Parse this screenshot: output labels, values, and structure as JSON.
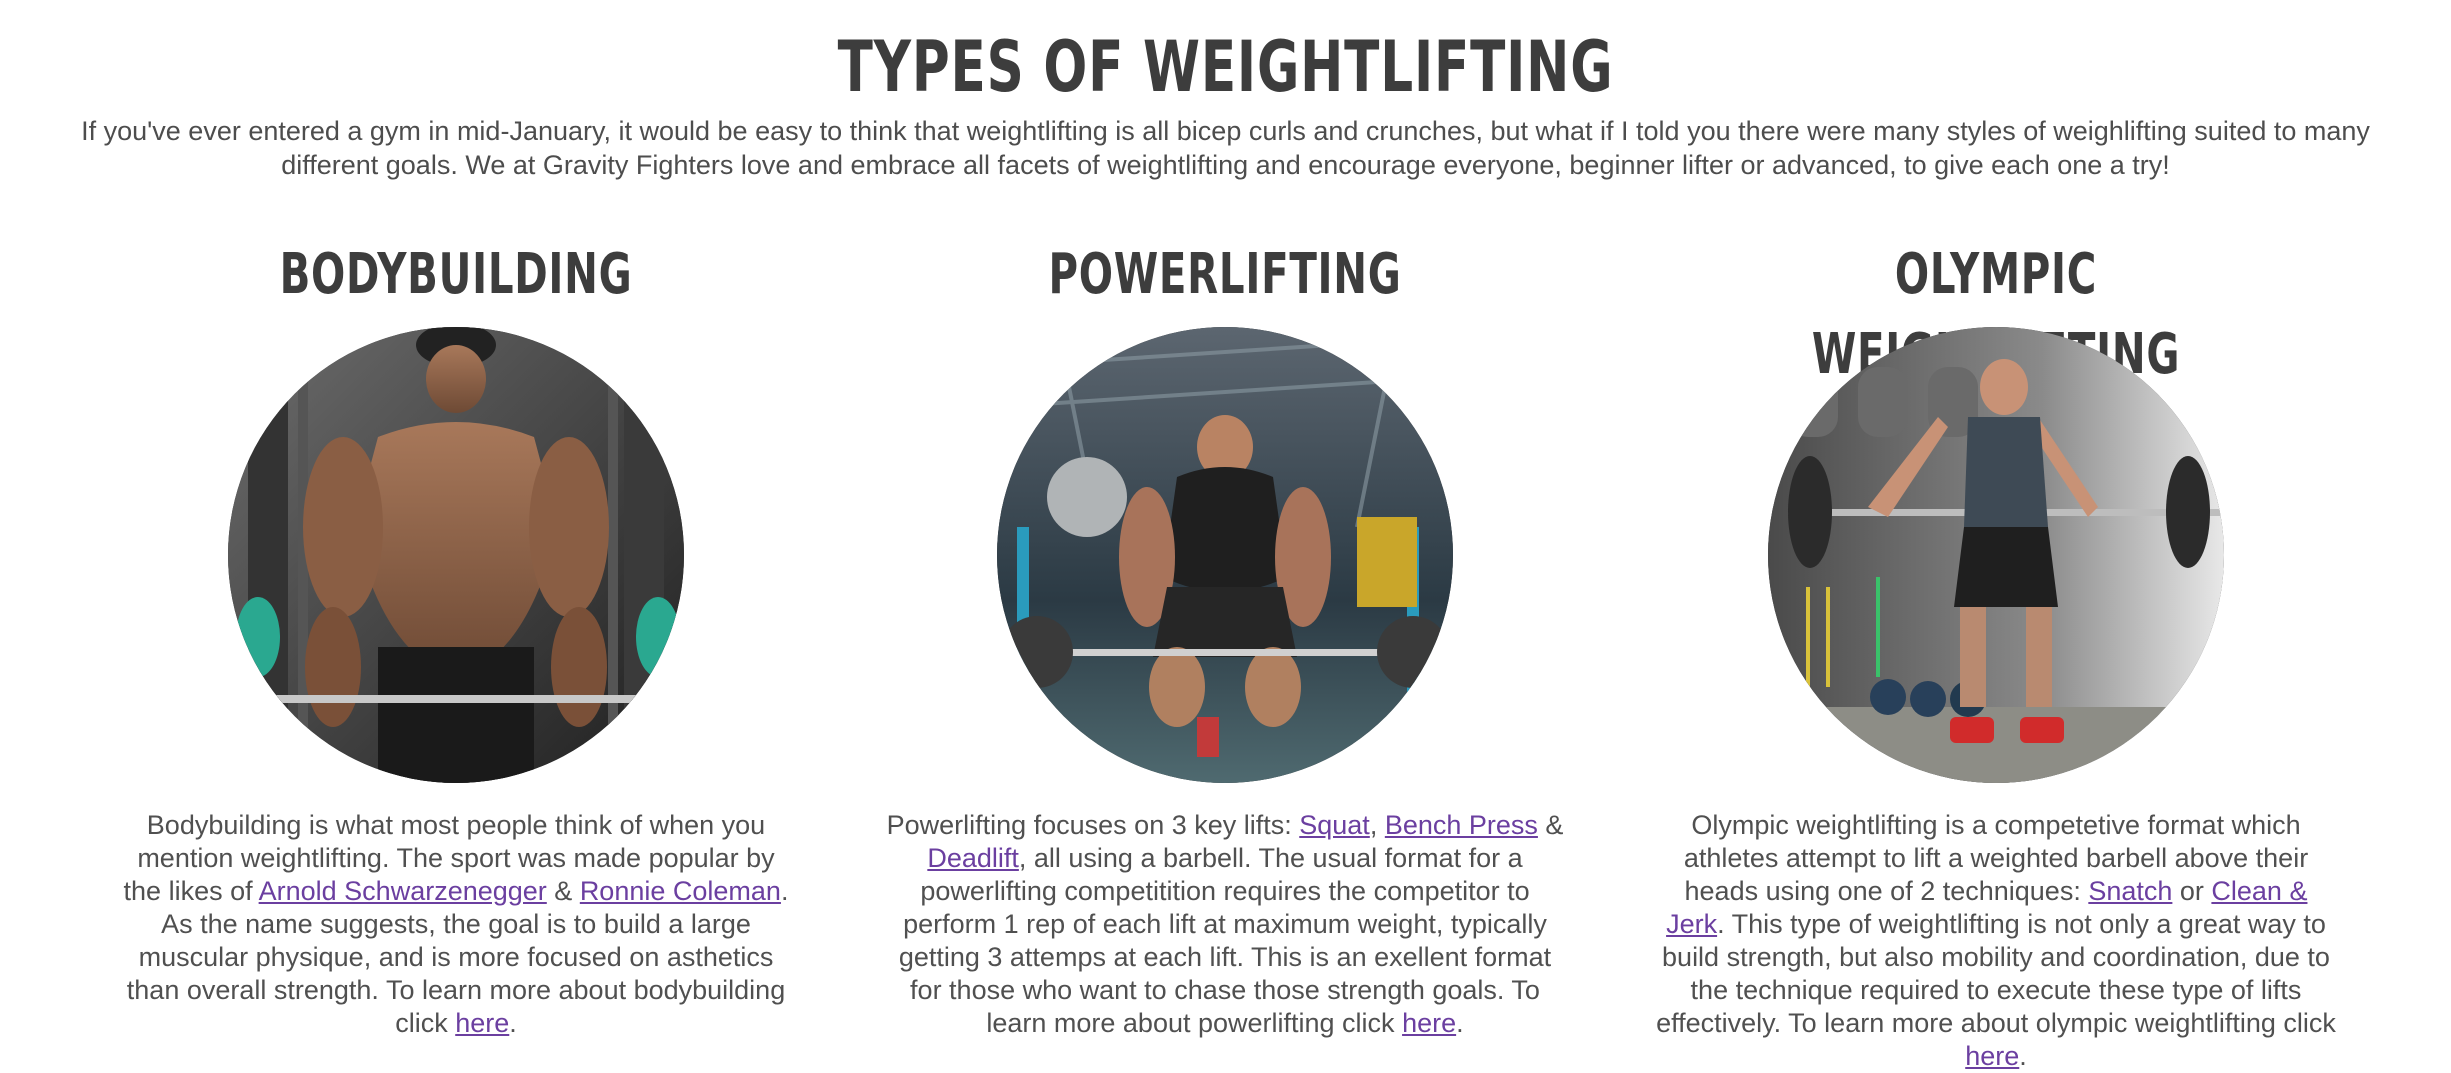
{
  "page": {
    "title": "TYPES OF WEIGHTLIFTING",
    "intro": "If you've ever entered a gym in mid-January, it would be easy to think that weightlifting is all bicep curls and crunches, but what if I told you there were many styles of weighlifting suited to many different goals. We at Gravity Fighters love and embrace all facets of weightlifting and encourage everyone, beginner lifter or advanced, to give each one a try!"
  },
  "bodybuilding": {
    "heading": "BODYBUILDING",
    "image_alt": "muscular bodybuilder holding curl bar",
    "text_1": "Bodybuilding is what most people think of when you mention weightlifting. The sport was made popular by the likes of ",
    "link_1": "Arnold Schwarzenegger",
    "text_2": " & ",
    "link_2": "Ronnie Coleman",
    "text_3": ". As the name suggests, the goal is to build a large muscular physique, and is more focused on asthetics than overall strength. To learn more about bodybuilding click ",
    "link_3": "here",
    "text_4": "."
  },
  "powerlifting": {
    "heading": "POWERLIFTING",
    "image_alt": "lifter gripping barbell for deadlift",
    "text_1": "Powerlifting focuses on 3 key lifts: ",
    "link_1": "Squat",
    "text_2": ", ",
    "link_2": "Bench Press",
    "text_3": " & ",
    "link_3": "Deadlift",
    "text_4": ", all using a barbell. The usual format for a powerlifting competitition requires the competitor to perform 1 rep of each lift at maximum weight, typically getting 3 attemps at each lift. This is an exellent format for those who want to chase those strength goals. To learn more about powerlifting click ",
    "link_4": "here",
    "text_5": "."
  },
  "olympic": {
    "heading": "OLYMPIC WEIGHTLIFTING",
    "image_alt": "athlete performing snatch with barbell",
    "text_1": "Olympic weightlifting is a competetive format which athletes attempt to lift a weighted barbell above their heads using one of 2 techniques: ",
    "link_1": "Snatch",
    "text_2": " or ",
    "link_2": "Clean & Jerk",
    "text_3": ". This type of weightlifting is not only a great way to build strength, but also mobility and coordination, due to the technique required to execute these type of lifts effectively. To learn more about olympic weightlifting click ",
    "link_3": "here",
    "text_4": "."
  }
}
